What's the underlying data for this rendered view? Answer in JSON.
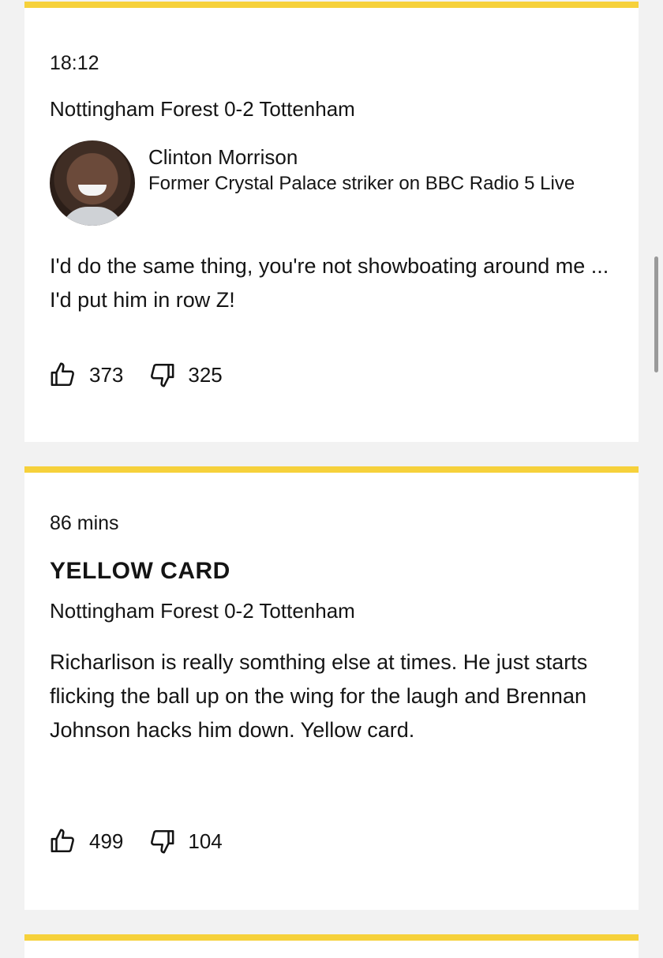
{
  "entries": [
    {
      "time": "18:12",
      "headline": "Nottingham Forest 0-2 Tottenham",
      "author": {
        "name": "Clinton Morrison",
        "role": "Former Crystal Palace striker on BBC Radio 5 Live"
      },
      "body": "I'd do the same thing, you're not showboating around me ... I'd put him in row Z!",
      "likes": "373",
      "dislikes": "325"
    },
    {
      "time": "86 mins",
      "label": "YELLOW CARD",
      "headline": "Nottingham Forest 0-2 Tottenham",
      "body": "Richarlison is really somthing else at times. He just starts flicking the ball up on the wing for the laugh and Brennan Johnson hacks him down. Yellow card.",
      "likes": "499",
      "dislikes": "104"
    }
  ],
  "colors": {
    "accent_bar": "#f6d13b",
    "card_bg": "#ffffff",
    "page_bg": "#f2f2f2",
    "text": "#141414"
  }
}
